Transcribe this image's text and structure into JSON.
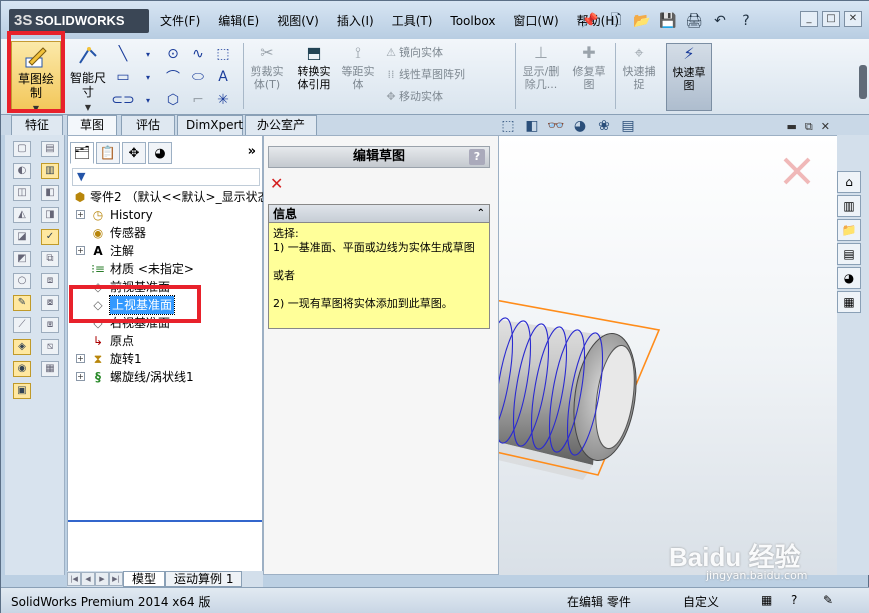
{
  "app": {
    "logo": "SOLIDWORKS",
    "logo_mark": "3S"
  },
  "menu": [
    "文件(F)",
    "编辑(E)",
    "视图(V)",
    "插入(I)",
    "工具(T)",
    "Toolbox",
    "窗口(W)",
    "帮助(H)"
  ],
  "window_controls": {
    "minimize": "_",
    "restore": "□",
    "close": "✕"
  },
  "ribbon": {
    "sketch": "草图绘\n制",
    "smart_dim": "智能尺\n寸",
    "trim": "剪裁实\n体(T)",
    "convert": "转换实\n体引用",
    "offset": "等距实\n体",
    "mirror": "镜向实体",
    "linear_pattern": "线性草图阵列",
    "move": "移动实体",
    "show_delete": "显示/删\n除几...",
    "repair": "修复草\n图",
    "quick_snap": "快速捕\n捉",
    "quick_sketch": "快速草\n图"
  },
  "cmd_tabs": [
    "特征",
    "草图",
    "评估",
    "DimXpert",
    "办公室产品"
  ],
  "fm_expand": "»",
  "tree": {
    "root": "零件2 （默认<<默认>_显示状态",
    "items": [
      {
        "label": "History",
        "expand": true,
        "icon": "history-icon"
      },
      {
        "label": "传感器",
        "expand": false,
        "icon": "sensor-icon"
      },
      {
        "label": "注解",
        "expand": true,
        "icon": "annotation-icon"
      },
      {
        "label": "材质 <未指定>",
        "expand": false,
        "icon": "material-icon"
      },
      {
        "label": "前视基准面",
        "expand": false,
        "icon": "plane-icon"
      },
      {
        "label": "上视基准面",
        "expand": false,
        "icon": "plane-icon",
        "selected": true
      },
      {
        "label": "右视基准面",
        "expand": false,
        "icon": "plane-icon"
      },
      {
        "label": "原点",
        "expand": false,
        "icon": "origin-icon"
      },
      {
        "label": "旋转1",
        "expand": true,
        "icon": "revolve-icon"
      },
      {
        "label": "螺旋线/涡状线1",
        "expand": true,
        "icon": "helix-icon"
      }
    ]
  },
  "property_manager": {
    "title": "编辑草图",
    "help": "?",
    "info_header": "信息",
    "info_lines": [
      "选择:",
      "1) 一基准面、平面或边线为实体生成草图",
      "或者",
      "2) 一现有草图将实体添加到此草图。"
    ]
  },
  "bottom_tabs": [
    "模型",
    "运动算例 1"
  ],
  "status": {
    "product": "SolidWorks Premium 2014 x64 版",
    "editing": "在编辑 零件",
    "custom": "自定义"
  },
  "watermark": {
    "brand": "Baidu 经验",
    "url": "jingyan.baidu.com"
  },
  "colors": {
    "highlight": "#e8212b",
    "selection": "#3399ff",
    "info_bg": "#ffff99",
    "helix": "#2a2ad0",
    "frame": "#ff8c1a"
  }
}
